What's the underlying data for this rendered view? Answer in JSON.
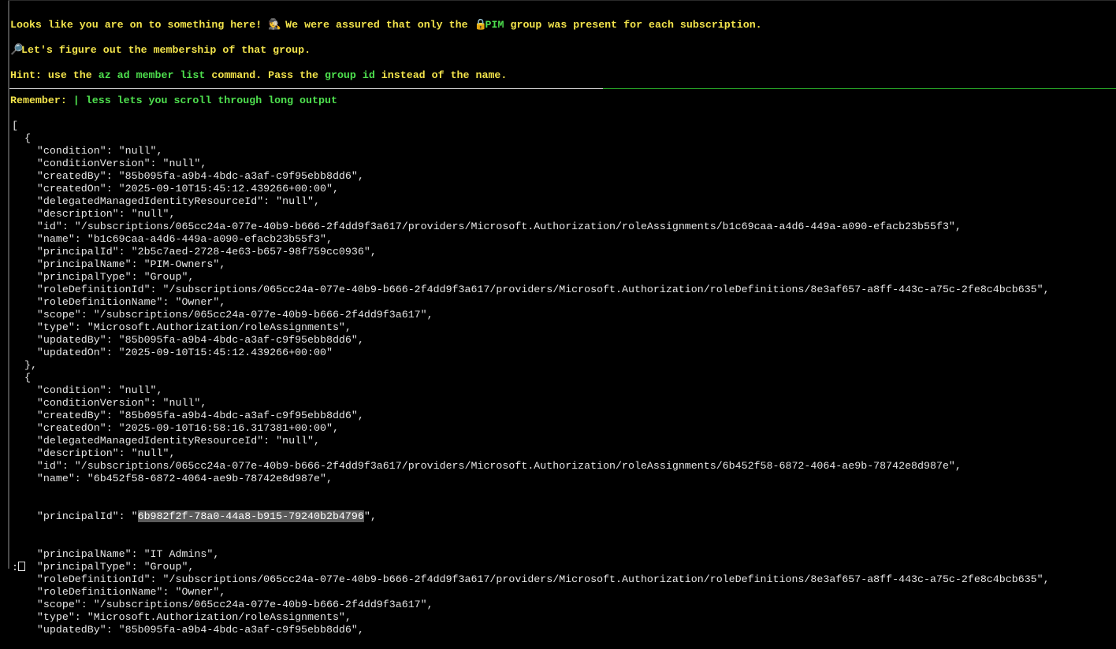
{
  "top": {
    "line1_a": "Looks like you are on to something here! ",
    "line1_icon1": "🕵",
    "line1_b": " We were assured that only the ",
    "line1_icon2": "🔒",
    "line1_pim": "PIM",
    "line1_c": " group was present for each subscription.",
    "line2_icon": "🔎",
    "line2": "Let's figure out the membership of that group.",
    "line3_a": "Hint: use the ",
    "line3_cmd": "az ad member list",
    "line3_b": " command. Pass the ",
    "line3_gid": "group id",
    "line3_c": " instead of the name.",
    "line4_a": "Remember: ",
    "line4_b": "| less lets you scroll through long output"
  },
  "output_lines": [
    "[",
    "  {",
    "    \"condition\": \"null\",",
    "    \"conditionVersion\": \"null\",",
    "    \"createdBy\": \"85b095fa-a9b4-4bdc-a3af-c9f95ebb8dd6\",",
    "    \"createdOn\": \"2025-09-10T15:45:12.439266+00:00\",",
    "    \"delegatedManagedIdentityResourceId\": \"null\",",
    "    \"description\": \"null\",",
    "    \"id\": \"/subscriptions/065cc24a-077e-40b9-b666-2f4dd9f3a617/providers/Microsoft.Authorization/roleAssignments/b1c69caa-a4d6-449a-a090-efacb23b55f3\",",
    "    \"name\": \"b1c69caa-a4d6-449a-a090-efacb23b55f3\",",
    "    \"principalId\": \"2b5c7aed-2728-4e63-b657-98f759cc0936\",",
    "    \"principalName\": \"PIM-Owners\",",
    "    \"principalType\": \"Group\",",
    "    \"roleDefinitionId\": \"/subscriptions/065cc24a-077e-40b9-b666-2f4dd9f3a617/providers/Microsoft.Authorization/roleDefinitions/8e3af657-a8ff-443c-a75c-2fe8c4bcb635\",",
    "    \"roleDefinitionName\": \"Owner\",",
    "    \"scope\": \"/subscriptions/065cc24a-077e-40b9-b666-2f4dd9f3a617\",",
    "    \"type\": \"Microsoft.Authorization/roleAssignments\",",
    "    \"updatedBy\": \"85b095fa-a9b4-4bdc-a3af-c9f95ebb8dd6\",",
    "    \"updatedOn\": \"2025-09-10T15:45:12.439266+00:00\"",
    "  },",
    "  {",
    "    \"condition\": \"null\",",
    "    \"conditionVersion\": \"null\",",
    "    \"createdBy\": \"85b095fa-a9b4-4bdc-a3af-c9f95ebb8dd6\",",
    "    \"createdOn\": \"2025-09-10T16:58:16.317381+00:00\",",
    "    \"delegatedManagedIdentityResourceId\": \"null\",",
    "    \"description\": \"null\",",
    "    \"id\": \"/subscriptions/065cc24a-077e-40b9-b666-2f4dd9f3a617/providers/Microsoft.Authorization/roleAssignments/6b452f58-6872-4064-ae9b-78742e8d987e\",",
    "    \"name\": \"6b452f58-6872-4064-ae9b-78742e8d987e\","
  ],
  "highlight_line": {
    "prefix": "    \"principalId\": \"",
    "selected": "6b982f2f-78a0-44a8-b915-79240b2b4796",
    "suffix": "\","
  },
  "output_lines_after": [
    "    \"principalName\": \"IT Admins\",",
    "    \"principalType\": \"Group\",",
    "    \"roleDefinitionId\": \"/subscriptions/065cc24a-077e-40b9-b666-2f4dd9f3a617/providers/Microsoft.Authorization/roleDefinitions/8e3af657-a8ff-443c-a75c-2fe8c4bcb635\",",
    "    \"roleDefinitionName\": \"Owner\",",
    "    \"scope\": \"/subscriptions/065cc24a-077e-40b9-b666-2f4dd9f3a617\",",
    "    \"type\": \"Microsoft.Authorization/roleAssignments\",",
    "    \"updatedBy\": \"85b095fa-a9b4-4bdc-a3af-c9f95ebb8dd6\","
  ],
  "prompt": ":"
}
